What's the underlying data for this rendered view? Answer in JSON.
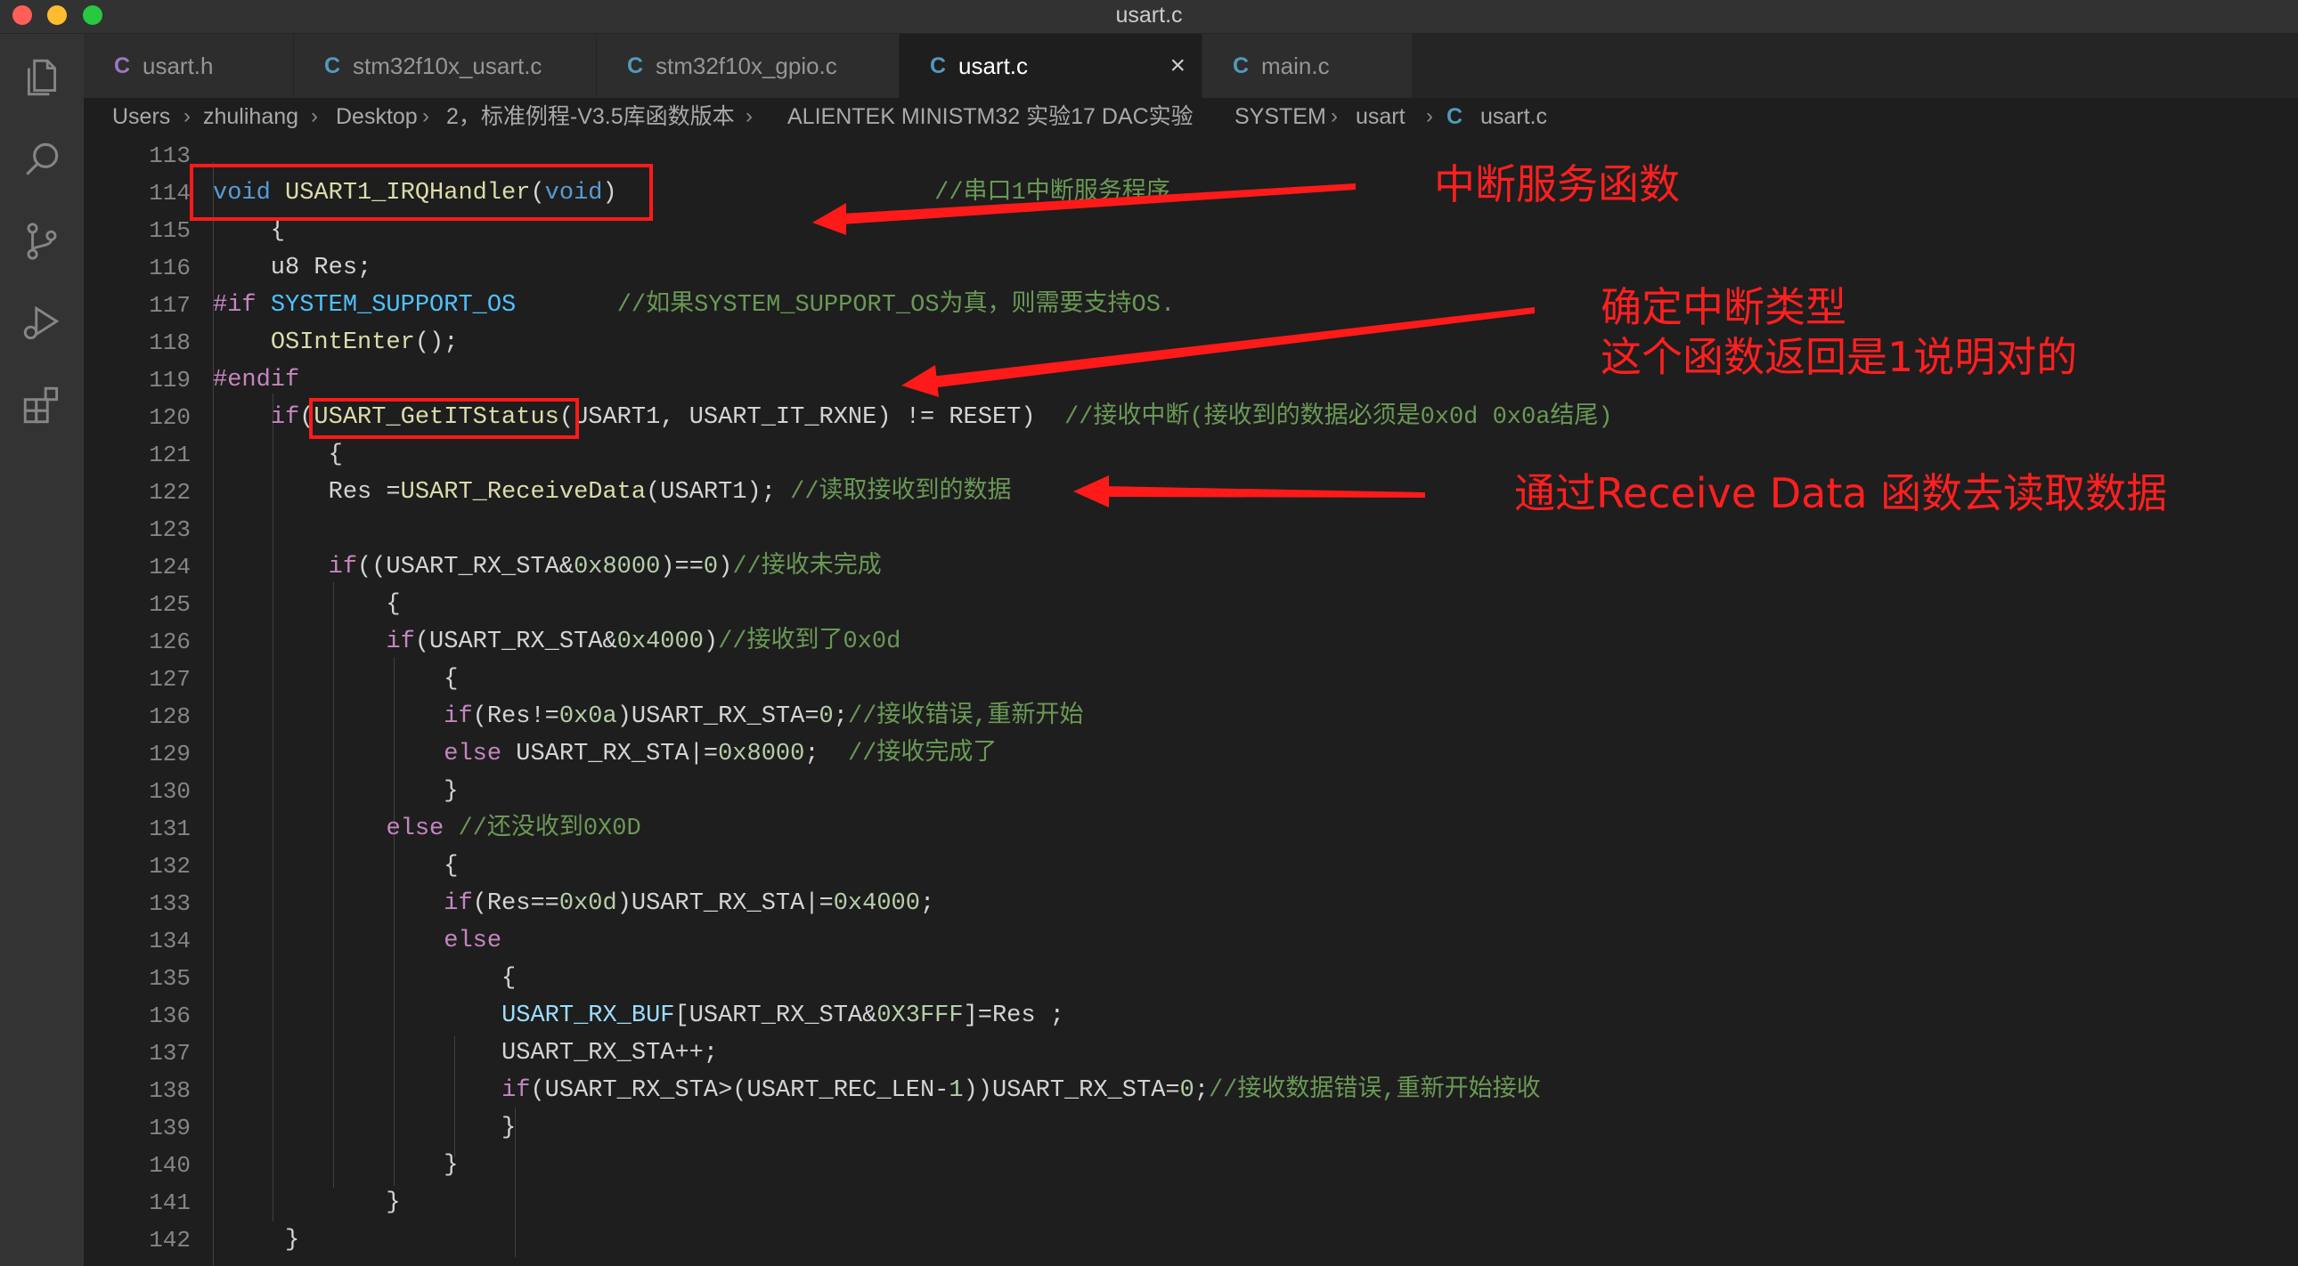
{
  "window": {
    "title": "usart.c"
  },
  "activity_icons": [
    "explorer-icon",
    "search-icon",
    "source-control-icon",
    "run-debug-icon",
    "extensions-icon"
  ],
  "tabs": [
    {
      "icon": "C",
      "label": "usart.h",
      "icon_color": "#a074c4",
      "active": false
    },
    {
      "icon": "C",
      "label": "stm32f10x_usart.c",
      "icon_color": "#519aba",
      "active": false
    },
    {
      "icon": "C",
      "label": "stm32f10x_gpio.c",
      "icon_color": "#519aba",
      "active": false
    },
    {
      "icon": "C",
      "label": "usart.c",
      "icon_color": "#519aba",
      "active": true,
      "close": "×"
    },
    {
      "icon": "C",
      "label": "main.c",
      "icon_color": "#519aba",
      "active": false
    }
  ],
  "breadcrumb": [
    "Users",
    "zhulihang",
    "Desktop",
    "2，标准例程-V3.5库函数版本",
    "ALIENTEK MINISTM32 实验17 DAC实验",
    "SYSTEM",
    "usart",
    "usart.c"
  ],
  "breadcrumb_file_icon": "C",
  "line_numbers": [
    "113",
    "114",
    "115",
    "116",
    "117",
    "118",
    "119",
    "120",
    "121",
    "122",
    "123",
    "124",
    "125",
    "126",
    "127",
    "128",
    "129",
    "130",
    "131",
    "132",
    "133",
    "134",
    "135",
    "136",
    "137",
    "138",
    "139",
    "140",
    "141",
    "142"
  ],
  "code": [
    [],
    [
      [
        "void ",
        "type"
      ],
      [
        "USART1_IRQHandler",
        "fn"
      ],
      [
        "(",
        "plain"
      ],
      [
        "void",
        "type"
      ],
      [
        ")",
        "plain"
      ],
      [
        "                      ",
        "plain"
      ],
      [
        "//串口1中断服务程序",
        "cmt"
      ]
    ],
    [
      [
        "    {",
        "plain"
      ]
    ],
    [
      [
        "    u8 Res;",
        "plain"
      ]
    ],
    [
      [
        "#if ",
        "kw"
      ],
      [
        "SYSTEM_SUPPORT_OS",
        "mac"
      ],
      [
        "       ",
        "plain"
      ],
      [
        "//如果SYSTEM_SUPPORT_OS为真，则需要支持OS.",
        "cmt"
      ]
    ],
    [
      [
        "    ",
        "plain"
      ],
      [
        "OSIntEnter",
        "fn"
      ],
      [
        "();",
        "plain"
      ]
    ],
    [
      [
        "#endif",
        "kw"
      ]
    ],
    [
      [
        "    ",
        "plain"
      ],
      [
        "if",
        "kw"
      ],
      [
        "(",
        "plain"
      ],
      [
        "USART_GetITStatus",
        "fn"
      ],
      [
        "(USART1, USART_IT_RXNE) != RESET)  ",
        "plain"
      ],
      [
        "//接收中断(接收到的数据必须是0x0d 0x0a结尾)",
        "cmt"
      ]
    ],
    [
      [
        "        {",
        "plain"
      ]
    ],
    [
      [
        "        Res =",
        "plain"
      ],
      [
        "USART_ReceiveData",
        "fn"
      ],
      [
        "(USART1); ",
        "plain"
      ],
      [
        "//读取接收到的数据",
        "cmt"
      ]
    ],
    [],
    [
      [
        "        ",
        "plain"
      ],
      [
        "if",
        "kw"
      ],
      [
        "((USART_RX_STA&",
        "plain"
      ],
      [
        "0x8000",
        "num"
      ],
      [
        ")==",
        "plain"
      ],
      [
        "0",
        "num"
      ],
      [
        ")",
        "plain"
      ],
      [
        "//接收未完成",
        "cmt"
      ]
    ],
    [
      [
        "            {",
        "plain"
      ]
    ],
    [
      [
        "            ",
        "plain"
      ],
      [
        "if",
        "kw"
      ],
      [
        "(USART_RX_STA&",
        "plain"
      ],
      [
        "0x4000",
        "num"
      ],
      [
        ")",
        "plain"
      ],
      [
        "//接收到了0x0d",
        "cmt"
      ]
    ],
    [
      [
        "                {",
        "plain"
      ]
    ],
    [
      [
        "                ",
        "plain"
      ],
      [
        "if",
        "kw"
      ],
      [
        "(Res!=",
        "plain"
      ],
      [
        "0x0a",
        "num"
      ],
      [
        ")USART_RX_STA=",
        "plain"
      ],
      [
        "0",
        "num"
      ],
      [
        ";",
        "plain"
      ],
      [
        "//接收错误,重新开始",
        "cmt"
      ]
    ],
    [
      [
        "                ",
        "plain"
      ],
      [
        "else",
        "kw"
      ],
      [
        " USART_RX_STA|=",
        "plain"
      ],
      [
        "0x8000",
        "num"
      ],
      [
        ";  ",
        "plain"
      ],
      [
        "//接收完成了",
        "cmt"
      ]
    ],
    [
      [
        "                }",
        "plain"
      ]
    ],
    [
      [
        "            ",
        "plain"
      ],
      [
        "else",
        "kw"
      ],
      [
        " ",
        "plain"
      ],
      [
        "//还没收到0X0D",
        "cmt"
      ]
    ],
    [
      [
        "                {",
        "plain"
      ]
    ],
    [
      [
        "                ",
        "plain"
      ],
      [
        "if",
        "kw"
      ],
      [
        "(Res==",
        "plain"
      ],
      [
        "0x0d",
        "num"
      ],
      [
        ")USART_RX_STA|=",
        "plain"
      ],
      [
        "0x4000",
        "num"
      ],
      [
        ";",
        "plain"
      ]
    ],
    [
      [
        "                ",
        "plain"
      ],
      [
        "else",
        "kw"
      ]
    ],
    [
      [
        "                    {",
        "plain"
      ]
    ],
    [
      [
        "                    ",
        "plain"
      ],
      [
        "USART_RX_BUF",
        "var"
      ],
      [
        "[USART_RX_STA&",
        "plain"
      ],
      [
        "0X3FFF",
        "num"
      ],
      [
        "]=Res ;",
        "plain"
      ]
    ],
    [
      [
        "                    USART_RX_STA++;",
        "plain"
      ]
    ],
    [
      [
        "                    ",
        "plain"
      ],
      [
        "if",
        "kw"
      ],
      [
        "(USART_RX_STA>(USART_REC_LEN-",
        "plain"
      ],
      [
        "1",
        "num"
      ],
      [
        "))USART_RX_STA=",
        "plain"
      ],
      [
        "0",
        "num"
      ],
      [
        ";",
        "plain"
      ],
      [
        "//接收数据错误,重新开始接收",
        "cmt"
      ]
    ],
    [
      [
        "                    }",
        "plain"
      ]
    ],
    [
      [
        "                }",
        "plain"
      ]
    ],
    [
      [
        "            }",
        "plain"
      ]
    ],
    [
      [
        "     }",
        "plain"
      ]
    ]
  ],
  "annotations": {
    "isr": "中断服务函数",
    "type_line1": "确定中断类型",
    "type_line2": "这个函数返回是1说明对的",
    "receive": "通过Receive Data 函数去读取数据"
  },
  "colors": {
    "annotation": "#ff1f1f",
    "keyword": "#c586c0",
    "type": "#569cd6",
    "function": "#dcdcaa",
    "comment": "#6a9955",
    "number": "#b5cea8"
  }
}
